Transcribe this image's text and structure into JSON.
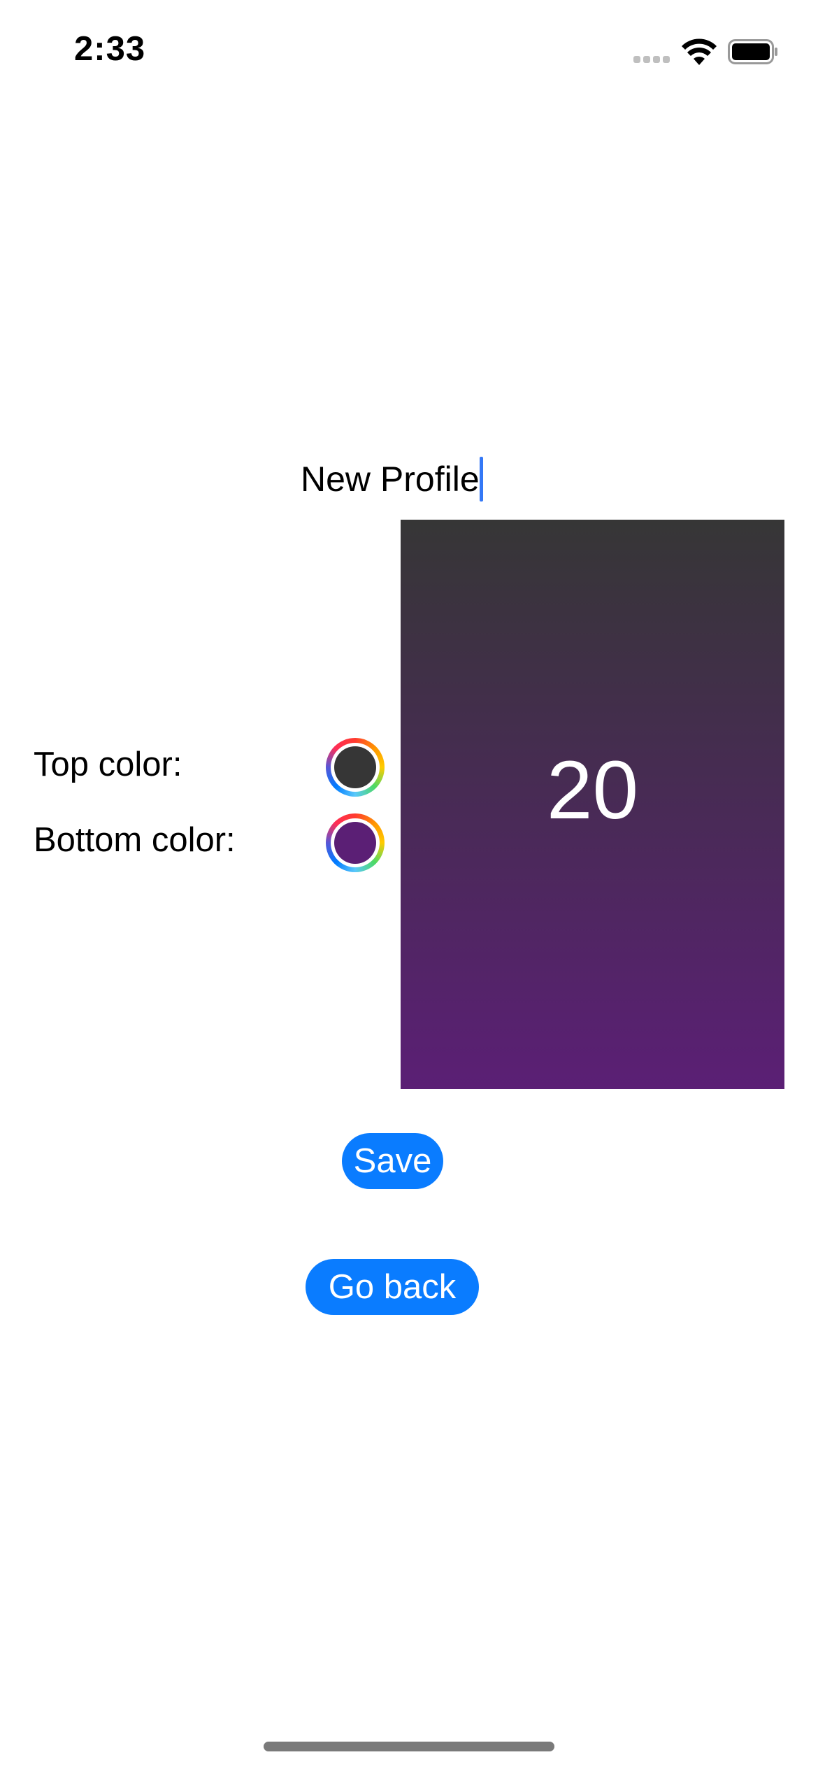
{
  "status_bar": {
    "time": "2:33"
  },
  "profile": {
    "name": "New Profile"
  },
  "colors": {
    "top_label": "Top color:",
    "bottom_label": "Bottom color:",
    "top_color": "#363636",
    "bottom_color": "#5b1f75",
    "accent": "#0a7cff"
  },
  "preview": {
    "value": "20"
  },
  "buttons": {
    "save_label": "Save",
    "back_label": "Go back"
  },
  "icons": {
    "signal": "cellular-signal-icon",
    "wifi": "wifi-icon",
    "battery": "battery-icon",
    "color_picker": "color-wheel-icon"
  }
}
